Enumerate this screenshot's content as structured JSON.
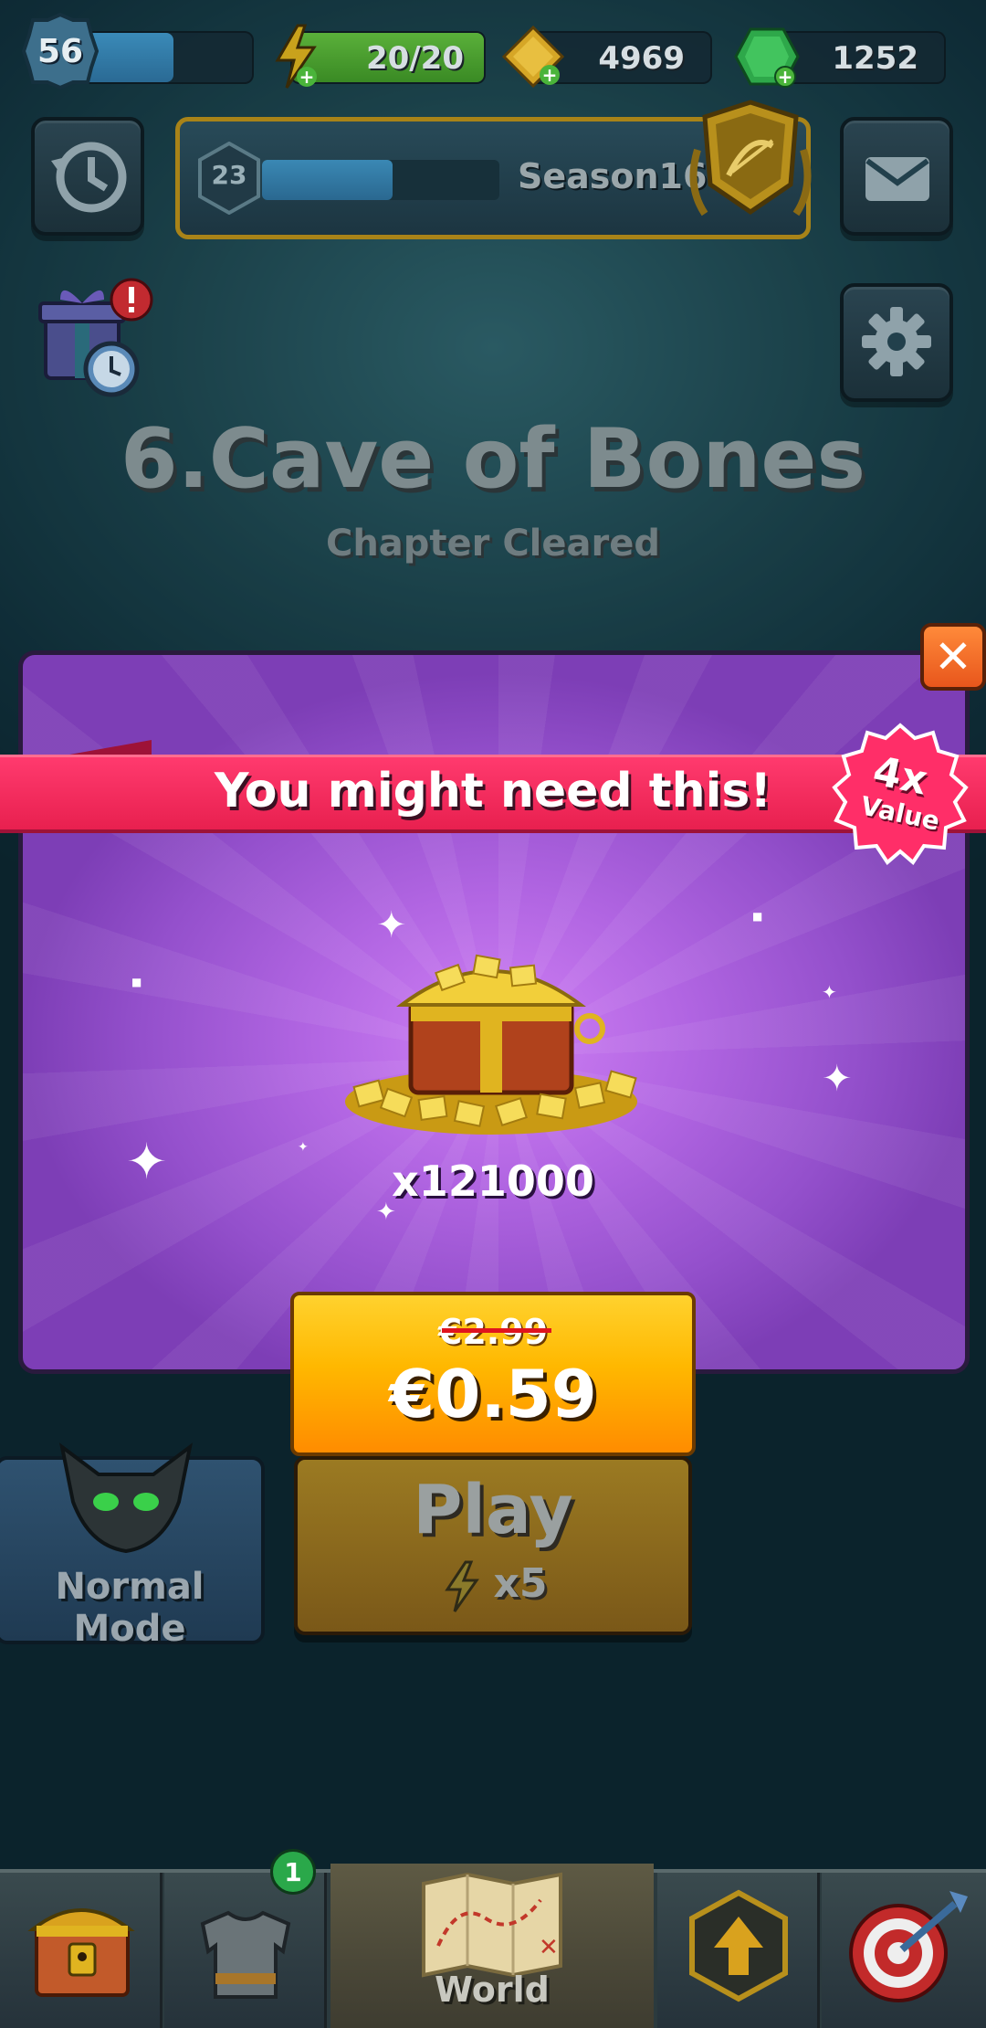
{
  "hud": {
    "player_level": "56",
    "energy": "20/20",
    "energy_fill": 1.0,
    "level_progress": 0.6,
    "gold": "4969",
    "gems": "1252"
  },
  "season": {
    "tier": "23",
    "label": "Season16",
    "progress": 0.55
  },
  "chapter": {
    "title": "6.Cave of Bones",
    "status": "Chapter Cleared"
  },
  "offer": {
    "banner": "You might need this!",
    "multiplier": "4x",
    "multiplier_caption": "Value",
    "quantity": "x121000",
    "old_price": "€2.99",
    "new_price": "€0.59",
    "close_icon": "close-icon"
  },
  "actions": {
    "mode": "Normal Mode",
    "play": "Play",
    "play_cost": "x5"
  },
  "nav": {
    "world": "World",
    "equipment_badge": "1"
  },
  "colors": {
    "banner": "#e8204f",
    "price_button": "#ffb800",
    "popup": "#b165e2"
  }
}
